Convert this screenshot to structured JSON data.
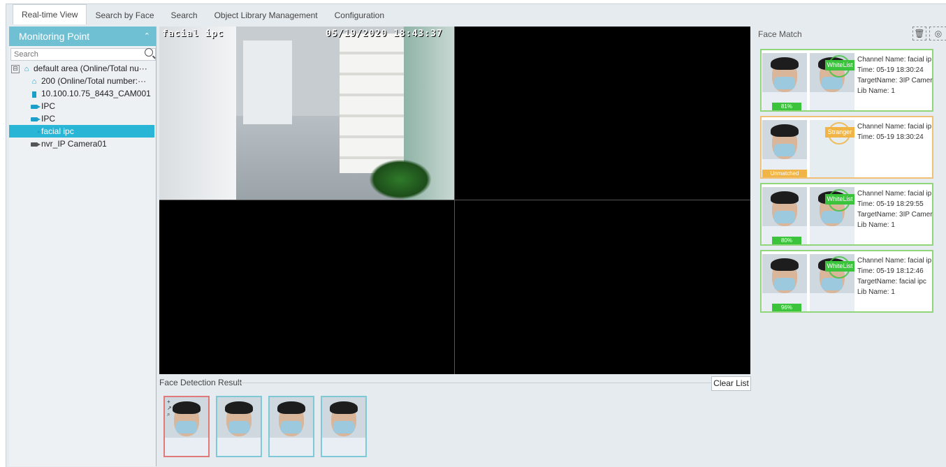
{
  "tabs": [
    {
      "label": "Real-time View",
      "active": true
    },
    {
      "label": "Search by Face"
    },
    {
      "label": "Search"
    },
    {
      "label": "Object Library Management"
    },
    {
      "label": "Configuration"
    }
  ],
  "sidebar": {
    "title": "Monitoring Point",
    "search_placeholder": "Search",
    "tree": [
      {
        "label": "default area (Online/Total nu···",
        "icon": "home-icon",
        "expander": "⊟"
      },
      {
        "label": "200 (Online/Total number:···",
        "icon": "home-icon"
      },
      {
        "label": "10.100.10.75_8443_CAM001",
        "icon": "device-icon"
      },
      {
        "label": "IPC",
        "icon": "camera-icon"
      },
      {
        "label": "IPC",
        "icon": "camera-icon"
      },
      {
        "label": "facial ipc",
        "icon": "camera-icon",
        "selected": true
      },
      {
        "label": "nvr_IP Camera01",
        "icon": "camera-offline-icon"
      }
    ]
  },
  "video": {
    "channel_osd": "facial ipc",
    "time_osd": "05/19/2020 18:43:37"
  },
  "detection": {
    "title": "Face Detection Result",
    "clear_label": "Clear List",
    "tools": [
      "+",
      "↗",
      "⌕"
    ]
  },
  "face_match": {
    "title": "Face Match",
    "cards": [
      {
        "type": "whitelist",
        "badge": "WhiteList",
        "score": "81%",
        "channel": "Channel Name: facial ip",
        "time": "Time: 05-19 18:30:24",
        "target": "TargetName: 3IP Camer",
        "lib": "Lib Name: 1"
      },
      {
        "type": "stranger",
        "badge": "Stranger",
        "score": "Unmatched",
        "channel": "Channel Name: facial ip",
        "time": "Time: 05-19 18:30:24",
        "target": "",
        "lib": ""
      },
      {
        "type": "whitelist",
        "badge": "WhiteList",
        "score": "80%",
        "channel": "Channel Name: facial ip",
        "time": "Time: 05-19 18:29:55",
        "target": "TargetName: 3IP Camer",
        "lib": "Lib Name: 1"
      },
      {
        "type": "whitelist",
        "badge": "WhiteList",
        "score": "96%",
        "channel": "Channel Name: facial ip",
        "time": "Time: 05-19 18:12:46",
        "target": "TargetName: facial ipc",
        "lib": "Lib Name: 1"
      }
    ]
  },
  "colors": {
    "accent": "#29b6d6",
    "header": "#6fc0d3",
    "match_green": "#3bc33b",
    "stranger_orange": "#f0b447"
  }
}
